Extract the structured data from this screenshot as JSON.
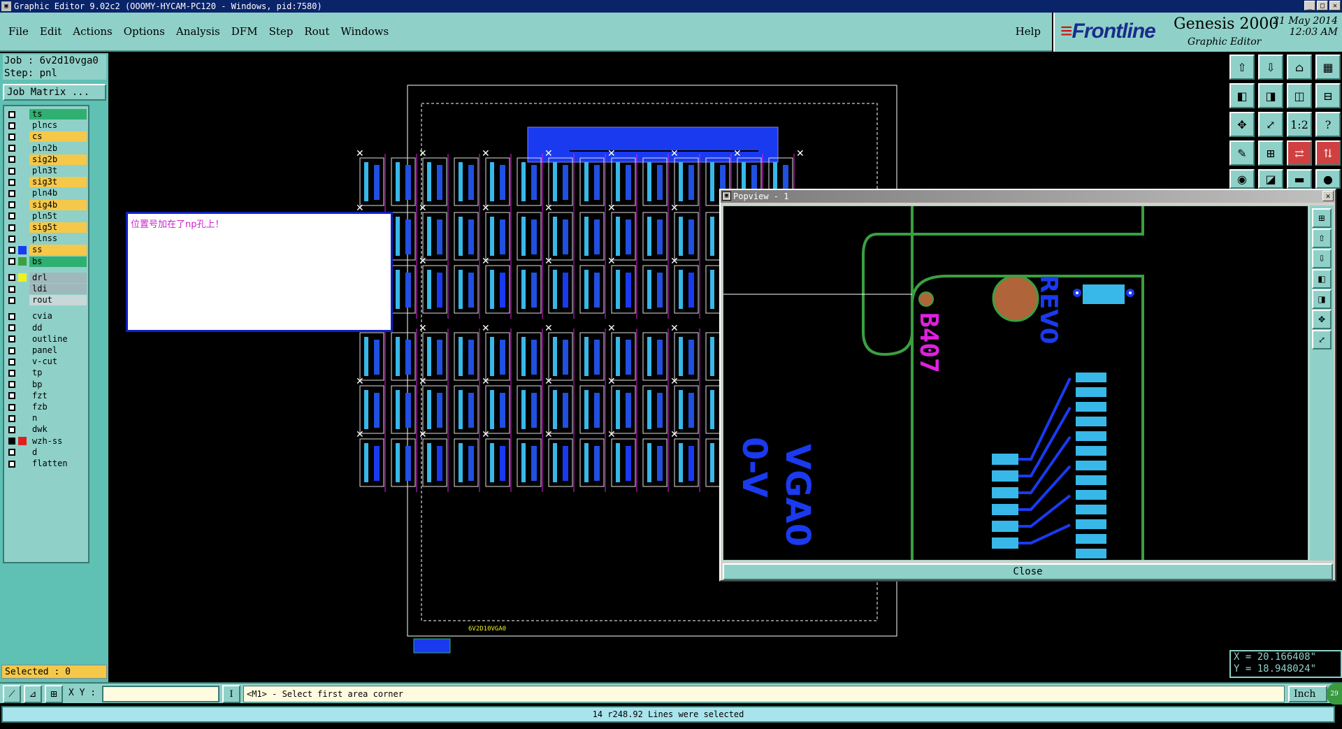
{
  "window": {
    "title": "Graphic Editor 9.02c2 (OOOMY-HYCAM-PC120 - Windows, pid:7580)"
  },
  "menu": {
    "items": [
      "File",
      "Edit",
      "Actions",
      "Options",
      "Analysis",
      "DFM",
      "Step",
      "Rout",
      "Windows"
    ],
    "help": "Help"
  },
  "brand": {
    "logo": "Frontline",
    "product": "Genesis 2000",
    "subtitle": "Graphic Editor",
    "date": "21 May 2014",
    "time": "12:03 AM"
  },
  "job": {
    "job_line": "Job : 6v2d10vga0",
    "step_line": "Step: pnl",
    "matrix_button": "Job Matrix ..."
  },
  "layers": [
    {
      "name": "ts",
      "color": "#2fb070",
      "checked": false,
      "swatch": ""
    },
    {
      "name": "plncs",
      "color": "#8fd1c8",
      "checked": false,
      "swatch": ""
    },
    {
      "name": "cs",
      "color": "#f5c84a",
      "checked": false,
      "swatch": ""
    },
    {
      "name": "pln2b",
      "color": "#8fd1c8",
      "checked": false,
      "swatch": ""
    },
    {
      "name": "sig2b",
      "color": "#f5c84a",
      "checked": false,
      "swatch": ""
    },
    {
      "name": "pln3t",
      "color": "#8fd1c8",
      "checked": false,
      "swatch": ""
    },
    {
      "name": "sig3t",
      "color": "#f5c84a",
      "checked": false,
      "swatch": ""
    },
    {
      "name": "pln4b",
      "color": "#8fd1c8",
      "checked": false,
      "swatch": ""
    },
    {
      "name": "sig4b",
      "color": "#f5c84a",
      "checked": false,
      "swatch": ""
    },
    {
      "name": "pln5t",
      "color": "#8fd1c8",
      "checked": false,
      "swatch": ""
    },
    {
      "name": "sig5t",
      "color": "#f5c84a",
      "checked": false,
      "swatch": ""
    },
    {
      "name": "plnss",
      "color": "#8fd1c8",
      "checked": false,
      "swatch": ""
    },
    {
      "name": "ss",
      "color": "#f5c84a",
      "checked": false,
      "swatch": "#1a3af0"
    },
    {
      "name": "bs",
      "color": "#2fb070",
      "checked": false,
      "swatch": "#3aa040"
    },
    {
      "name": "drl",
      "color": "#9fb8bc",
      "checked": false,
      "swatch": "#f0f020"
    },
    {
      "name": "ldi",
      "color": "#9fb8bc",
      "checked": false,
      "swatch": ""
    },
    {
      "name": "rout",
      "color": "#c8d8d8",
      "checked": false,
      "swatch": ""
    },
    {
      "name": "cvia",
      "color": "#8fd1c8",
      "checked": false,
      "swatch": ""
    },
    {
      "name": "dd",
      "color": "#8fd1c8",
      "checked": false,
      "swatch": ""
    },
    {
      "name": "outline",
      "color": "#8fd1c8",
      "checked": false,
      "swatch": ""
    },
    {
      "name": "panel",
      "color": "#8fd1c8",
      "checked": false,
      "swatch": ""
    },
    {
      "name": "v-cut",
      "color": "#8fd1c8",
      "checked": false,
      "swatch": ""
    },
    {
      "name": "tp",
      "color": "#8fd1c8",
      "checked": false,
      "swatch": ""
    },
    {
      "name": "bp",
      "color": "#8fd1c8",
      "checked": false,
      "swatch": ""
    },
    {
      "name": "fzt",
      "color": "#8fd1c8",
      "checked": false,
      "swatch": ""
    },
    {
      "name": "fzb",
      "color": "#8fd1c8",
      "checked": false,
      "swatch": ""
    },
    {
      "name": "n",
      "color": "#8fd1c8",
      "checked": false,
      "swatch": ""
    },
    {
      "name": "dwk",
      "color": "#8fd1c8",
      "checked": false,
      "swatch": ""
    },
    {
      "name": "wzh-ss",
      "color": "#8fd1c8",
      "checked": true,
      "swatch": "#e02020"
    },
    {
      "name": "d",
      "color": "#8fd1c8",
      "checked": false,
      "swatch": ""
    },
    {
      "name": "flatten",
      "color": "#8fd1c8",
      "checked": false,
      "swatch": ""
    }
  ],
  "selected_count": "Selected : 0",
  "note": "位置号加在了np孔上！",
  "board_label": "6V2D10VGA0",
  "popview": {
    "title": "Popview - 1",
    "text_ref": "B407",
    "text_rev": "REV0",
    "text_v": "0-V",
    "text_v2": "VGA0",
    "close_label": "Close"
  },
  "coords": {
    "x": "X = 20.166408\"",
    "y": "Y = 18.948024\""
  },
  "bottom": {
    "xy_label": "X Y :",
    "xy_value": "",
    "prompt": "<M1> - Select first area corner",
    "units": "Inch",
    "badge": "29"
  },
  "status": "14 r248.92 Lines were selected",
  "icons": {
    "tool_grid": [
      "page-up-icon",
      "page-down-icon",
      "home-icon",
      "grid-icon",
      "pan-left-icon",
      "pan-right-icon",
      "zoom-fit-icon",
      "zoom-icon",
      "fit-icon",
      "zoom-in-icon",
      "scale-icon",
      "help-icon",
      "layers-icon",
      "matrix-icon",
      "route-icon",
      "measure-icon"
    ]
  }
}
